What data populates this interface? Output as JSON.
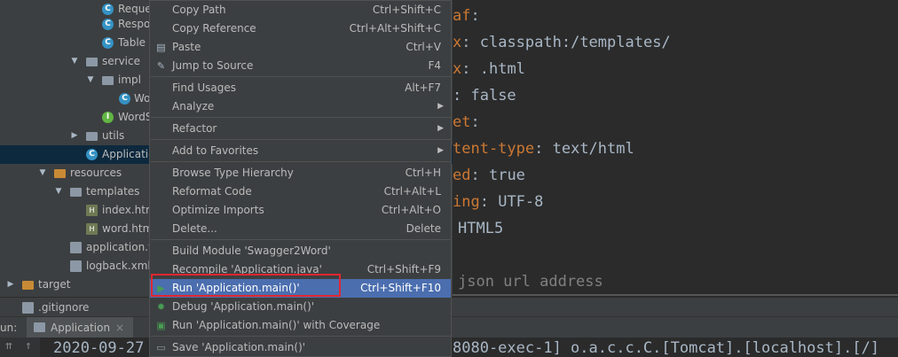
{
  "tree": {
    "rows": [
      {
        "label": "Reque",
        "icon": "class"
      },
      {
        "label": "Respo",
        "icon": "class"
      },
      {
        "label": "Table",
        "icon": "class"
      },
      {
        "label": "service",
        "icon": "folder"
      },
      {
        "label": "impl",
        "icon": "folder"
      },
      {
        "label": "Wo",
        "icon": "class"
      },
      {
        "label": "WordS",
        "icon": "interface"
      },
      {
        "label": "utils",
        "icon": "folder"
      },
      {
        "label": "Applicatio",
        "icon": "class"
      },
      {
        "label": "resources",
        "icon": "folder"
      },
      {
        "label": "templates",
        "icon": "folder"
      },
      {
        "label": "index.htm",
        "icon": "html"
      },
      {
        "label": "word.htm",
        "icon": "html"
      },
      {
        "label": "application.y",
        "icon": "doc"
      },
      {
        "label": "logback.xml",
        "icon": "doc"
      },
      {
        "label": "target",
        "icon": "folder"
      },
      {
        "label": ".gitignore",
        "icon": "doc"
      }
    ]
  },
  "editor": {
    "lines": [
      {
        "key": "af",
        "punct": ":",
        "val": ""
      },
      {
        "key": "x",
        "punct": ": ",
        "val": "classpath:/templates/"
      },
      {
        "key": "x",
        "punct": ": ",
        "val": ".html"
      },
      {
        "key": "",
        "punct": ": ",
        "val": "false"
      },
      {
        "key": "et",
        "punct": ":",
        "val": ""
      },
      {
        "key": "tent-type",
        "punct": ": ",
        "val": "text/html"
      },
      {
        "key": "ed",
        "punct": ": ",
        "val": "true"
      },
      {
        "key": "ing",
        "punct": ": ",
        "val": "UTF-8"
      },
      {
        "key": "",
        "punct": "",
        "val": "HTML5"
      },
      {
        "key": "",
        "punct": "",
        "val": ""
      },
      {
        "key": "",
        "punct": "",
        "val": "json url address"
      }
    ]
  },
  "run_panel": {
    "label": "un:",
    "tab": "Application",
    "close": "×"
  },
  "console": {
    "line_start": "2020-09-27",
    "line_end": "8080-exec-1] o.a.c.c.C.[Tomcat].[localhost].[/]"
  },
  "menu": {
    "items": [
      {
        "label": "Copy Path",
        "shortcut": "Ctrl+Shift+C",
        "icon": ""
      },
      {
        "label": "Copy Reference",
        "shortcut": "Ctrl+Alt+Shift+C",
        "icon": ""
      },
      {
        "label": "Paste",
        "shortcut": "Ctrl+V",
        "icon": "clipboard"
      },
      {
        "label": "Jump to Source",
        "shortcut": "F4",
        "icon": "pencil"
      },
      {
        "label": "Find Usages",
        "shortcut": "Alt+F7",
        "icon": ""
      },
      {
        "label": "Analyze",
        "shortcut": "",
        "icon": "",
        "submenu": true
      },
      {
        "label": "Refactor",
        "shortcut": "",
        "icon": "",
        "submenu": true
      },
      {
        "label": "Add to Favorites",
        "shortcut": "",
        "icon": "",
        "submenu": true
      },
      {
        "label": "Browse Type Hierarchy",
        "shortcut": "Ctrl+H",
        "icon": ""
      },
      {
        "label": "Reformat Code",
        "shortcut": "Ctrl+Alt+L",
        "icon": ""
      },
      {
        "label": "Optimize Imports",
        "shortcut": "Ctrl+Alt+O",
        "icon": ""
      },
      {
        "label": "Delete...",
        "shortcut": "Delete",
        "icon": ""
      },
      {
        "label": "Build Module 'Swagger2Word'",
        "shortcut": "",
        "icon": ""
      },
      {
        "label": "Recompile 'Application.java'",
        "shortcut": "Ctrl+Shift+F9",
        "icon": ""
      },
      {
        "label": "Run 'Application.main()'",
        "shortcut": "Ctrl+Shift+F10",
        "icon": "run"
      },
      {
        "label": "Debug 'Application.main()'",
        "shortcut": "",
        "icon": "debug"
      },
      {
        "label": "Run 'Application.main()' with Coverage",
        "shortcut": "",
        "icon": "coverage"
      },
      {
        "label": "Save 'Application.main()'",
        "shortcut": "",
        "icon": "save"
      }
    ],
    "submenu_glyph": "▶"
  },
  "colors": {
    "highlight": "#4b6eaf",
    "annotation": "#e3262f",
    "run_green": "#499c54"
  }
}
